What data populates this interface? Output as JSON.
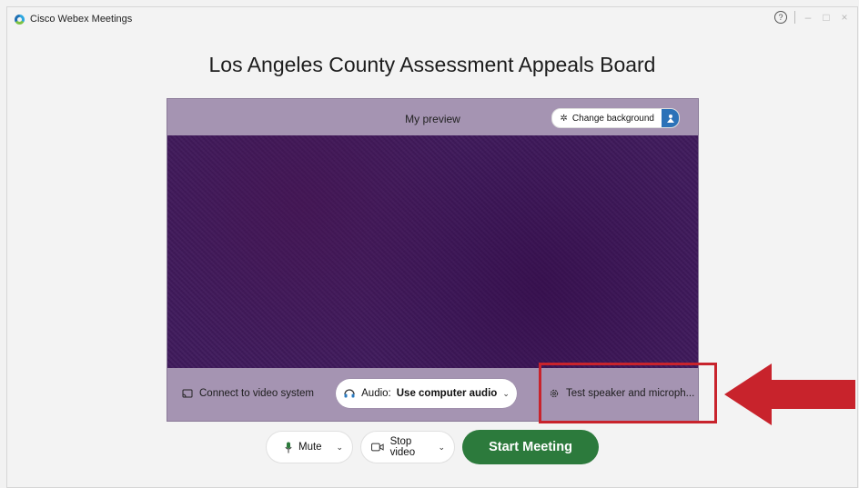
{
  "window": {
    "app_title": "Cisco Webex Meetings",
    "controls": {
      "help": "?",
      "minimize": "–",
      "maximize": "□",
      "close": "×"
    }
  },
  "meeting": {
    "title": "Los Angeles County Assessment Appeals Board"
  },
  "preview": {
    "label": "My preview",
    "change_background_label": "Change background",
    "icons": {
      "change_background": "wand-icon",
      "side_button": "person-icon"
    }
  },
  "preview_controls": {
    "connect_video_label": "Connect to video system",
    "audio_prefix": "Audio:",
    "audio_value": "Use computer audio",
    "test_speaker_label": "Test speaker and microph..."
  },
  "bottom_bar": {
    "mute_label": "Mute",
    "stop_video_label": "Stop video",
    "start_meeting_label": "Start Meeting"
  },
  "colors": {
    "start_button": "#2c7a3c",
    "highlight": "#c8232c",
    "preview_frame": "#a594b2",
    "video_feed": "#3e1a5b"
  }
}
